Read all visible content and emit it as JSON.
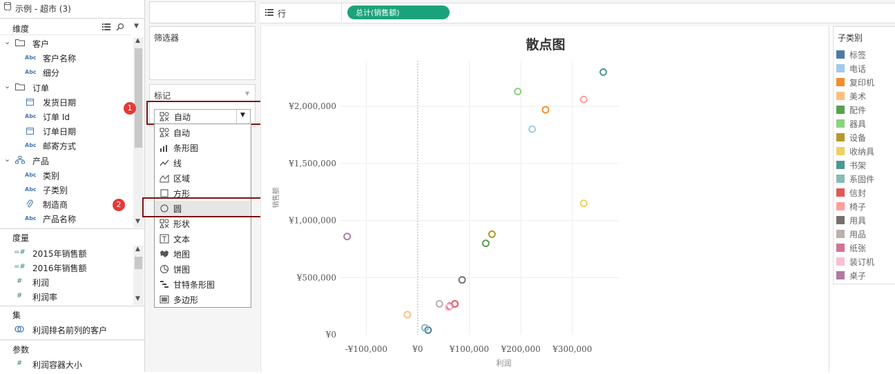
{
  "datasource": {
    "title": "示例 - 超市 (3)"
  },
  "dimensions": {
    "header": "维度",
    "items": [
      {
        "label": "客户",
        "type": "folder"
      },
      {
        "label": "客户名称",
        "type": "abc"
      },
      {
        "label": "细分",
        "type": "abc"
      },
      {
        "label": "订单",
        "type": "folder"
      },
      {
        "label": "发货日期",
        "type": "date"
      },
      {
        "label": "订单 Id",
        "type": "abc"
      },
      {
        "label": "订单日期",
        "type": "date"
      },
      {
        "label": "邮寄方式",
        "type": "abc"
      },
      {
        "label": "产品",
        "type": "hierarchy"
      },
      {
        "label": "类别",
        "type": "abc"
      },
      {
        "label": "子类别",
        "type": "abc"
      },
      {
        "label": "制造商",
        "type": "clip"
      },
      {
        "label": "产品名称",
        "type": "abc"
      }
    ],
    "abc_text": "Abc"
  },
  "measures": {
    "header": "度量",
    "items": [
      {
        "label": "2015年销售额"
      },
      {
        "label": "2016年销售额"
      },
      {
        "label": "利润"
      },
      {
        "label": "利润率"
      }
    ]
  },
  "sets": {
    "header": "集",
    "items": [
      {
        "label": "利润排名前列的客户"
      }
    ]
  },
  "parameters": {
    "header": "参数",
    "items": [
      {
        "label": "利润容器大小"
      }
    ]
  },
  "badges": [
    "1",
    "2"
  ],
  "filters": {
    "title": "筛选器"
  },
  "marks": {
    "title": "标记",
    "selected": "自动",
    "options": [
      {
        "label": "自动",
        "icon": "auto-icon"
      },
      {
        "label": "条形图",
        "icon": "bar-icon"
      },
      {
        "label": "线",
        "icon": "line-icon"
      },
      {
        "label": "区域",
        "icon": "area-icon"
      },
      {
        "label": "方形",
        "icon": "square-icon"
      },
      {
        "label": "圆",
        "icon": "circle-icon"
      },
      {
        "label": "形状",
        "icon": "shape-icon"
      },
      {
        "label": "文本",
        "icon": "text-icon"
      },
      {
        "label": "地图",
        "icon": "map-icon"
      },
      {
        "label": "饼图",
        "icon": "pie-icon"
      },
      {
        "label": "甘特条形图",
        "icon": "gantt-icon"
      },
      {
        "label": "多边形",
        "icon": "polygon-icon"
      }
    ]
  },
  "rows_shelf": {
    "label": "行",
    "pill": "总计(销售额)",
    "pill_color": "#1aa37a"
  },
  "legend": {
    "title": "子类别",
    "items": [
      {
        "label": "标签",
        "color": "#4e79a7"
      },
      {
        "label": "电话",
        "color": "#a0cbe8"
      },
      {
        "label": "复印机",
        "color": "#f28e2b"
      },
      {
        "label": "美术",
        "color": "#ffbe7d"
      },
      {
        "label": "配件",
        "color": "#59a14f"
      },
      {
        "label": "器具",
        "color": "#8cd17d"
      },
      {
        "label": "设备",
        "color": "#b6992d"
      },
      {
        "label": "收纳具",
        "color": "#f1ce63"
      },
      {
        "label": "书架",
        "color": "#499894"
      },
      {
        "label": "系固件",
        "color": "#86bcb6"
      },
      {
        "label": "信封",
        "color": "#e15759"
      },
      {
        "label": "椅子",
        "color": "#ff9d9a"
      },
      {
        "label": "用具",
        "color": "#79706e"
      },
      {
        "label": "用品",
        "color": "#bab0ac"
      },
      {
        "label": "纸张",
        "color": "#d37295"
      },
      {
        "label": "装订机",
        "color": "#fabfd2"
      },
      {
        "label": "桌子",
        "color": "#b07aa1"
      }
    ]
  },
  "chart_data": {
    "type": "scatter",
    "title": "散点图",
    "xlabel": "利润",
    "ylabel": "销售额",
    "xlim": [
      -150000,
      390000
    ],
    "ylim": [
      0,
      2400000
    ],
    "xticks": [
      -100000,
      0,
      100000,
      200000,
      300000
    ],
    "xtick_labels": [
      "-¥100,000",
      "¥0",
      "¥100,000",
      "¥200,000",
      "¥300,000"
    ],
    "yticks": [
      0,
      500000,
      1000000,
      1500000,
      2000000
    ],
    "ytick_labels": [
      "¥0",
      "¥500,000",
      "¥1,000,000",
      "¥1,500,000",
      "¥2,000,000"
    ],
    "grid": true,
    "points": [
      {
        "series": "标签",
        "x": 20000,
        "y": 40000
      },
      {
        "series": "电话",
        "x": 222000,
        "y": 1800000
      },
      {
        "series": "复印机",
        "x": 248000,
        "y": 1970000
      },
      {
        "series": "美术",
        "x": -20000,
        "y": 175000
      },
      {
        "series": "配件",
        "x": 132000,
        "y": 800000
      },
      {
        "series": "器具",
        "x": 194000,
        "y": 2130000
      },
      {
        "series": "设备",
        "x": 144000,
        "y": 880000
      },
      {
        "series": "收纳具",
        "x": 322000,
        "y": 1150000
      },
      {
        "series": "书架",
        "x": 360000,
        "y": 2300000
      },
      {
        "series": "系固件",
        "x": 14000,
        "y": 60000
      },
      {
        "series": "信封",
        "x": 72000,
        "y": 270000
      },
      {
        "series": "椅子",
        "x": 322000,
        "y": 2060000
      },
      {
        "series": "用具",
        "x": 86000,
        "y": 480000
      },
      {
        "series": "用品",
        "x": 42000,
        "y": 270000
      },
      {
        "series": "纸张",
        "x": 62000,
        "y": 250000
      },
      {
        "series": "装订机",
        "x": 60000,
        "y": 240000
      },
      {
        "series": "桌子",
        "x": -137000,
        "y": 860000
      }
    ]
  }
}
